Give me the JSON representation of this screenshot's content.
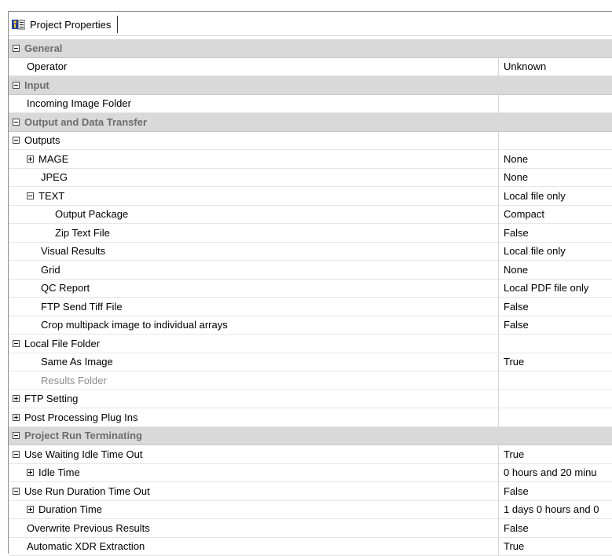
{
  "tab": {
    "title": "Project Properties",
    "icon": "project-properties-icon"
  },
  "rows": [
    {
      "kind": "category",
      "label": "General",
      "expander": "minus",
      "indent": 0
    },
    {
      "kind": "prop",
      "label": "Operator",
      "value": "Unknown",
      "indent": 1
    },
    {
      "kind": "category",
      "label": "Input",
      "expander": "minus",
      "indent": 0
    },
    {
      "kind": "prop",
      "label": "Incoming Image Folder",
      "value": "",
      "indent": 1
    },
    {
      "kind": "category",
      "label": "Output and Data Transfer",
      "expander": "minus",
      "indent": 0
    },
    {
      "kind": "prop",
      "label": "Outputs",
      "value": "",
      "indent": 0,
      "expander": "minus"
    },
    {
      "kind": "prop",
      "label": "MAGE",
      "value": "None",
      "indent": 1,
      "expander": "plus"
    },
    {
      "kind": "prop",
      "label": "JPEG",
      "value": "None",
      "indent": 2
    },
    {
      "kind": "prop",
      "label": "TEXT",
      "value": "Local file only",
      "indent": 1,
      "expander": "minus"
    },
    {
      "kind": "prop",
      "label": "Output Package",
      "value": "Compact",
      "indent": 3
    },
    {
      "kind": "prop",
      "label": "Zip Text File",
      "value": "False",
      "indent": 3
    },
    {
      "kind": "prop",
      "label": "Visual Results",
      "value": "Local file only",
      "indent": 2
    },
    {
      "kind": "prop",
      "label": "Grid",
      "value": "None",
      "indent": 2
    },
    {
      "kind": "prop",
      "label": "QC Report",
      "value": "Local PDF file only",
      "indent": 2
    },
    {
      "kind": "prop",
      "label": "FTP Send Tiff File",
      "value": "False",
      "indent": 2
    },
    {
      "kind": "prop",
      "label": "Crop multipack image to individual arrays",
      "value": "False",
      "indent": 2
    },
    {
      "kind": "prop",
      "label": "Local File Folder",
      "value": "",
      "indent": 0,
      "expander": "minus"
    },
    {
      "kind": "prop",
      "label": "Same As Image",
      "value": "True",
      "indent": 2
    },
    {
      "kind": "prop",
      "label": "Results Folder",
      "value": "",
      "indent": 2,
      "disabled": true
    },
    {
      "kind": "prop",
      "label": "FTP Setting",
      "value": "",
      "indent": 0,
      "expander": "plus"
    },
    {
      "kind": "prop",
      "label": "Post Processing Plug Ins",
      "value": "",
      "indent": 0,
      "expander": "plus"
    },
    {
      "kind": "category",
      "label": "Project Run Terminating",
      "expander": "minus",
      "indent": 0
    },
    {
      "kind": "prop",
      "label": "Use Waiting  Idle Time Out",
      "value": "True",
      "indent": 0,
      "expander": "minus"
    },
    {
      "kind": "prop",
      "label": "Idle Time",
      "value": "0 hours and 20 minu",
      "indent": 1,
      "expander": "plus"
    },
    {
      "kind": "prop",
      "label": "Use Run Duration Time Out",
      "value": "False",
      "indent": 0,
      "expander": "minus"
    },
    {
      "kind": "prop",
      "label": "Duration Time",
      "value": "1 days 0 hours and 0",
      "indent": 1,
      "expander": "plus"
    },
    {
      "kind": "prop",
      "label": "Overwrite Previous Results",
      "value": "False",
      "indent": 1
    },
    {
      "kind": "prop",
      "label": "Automatic XDR Extraction",
      "value": "True",
      "indent": 1
    }
  ]
}
